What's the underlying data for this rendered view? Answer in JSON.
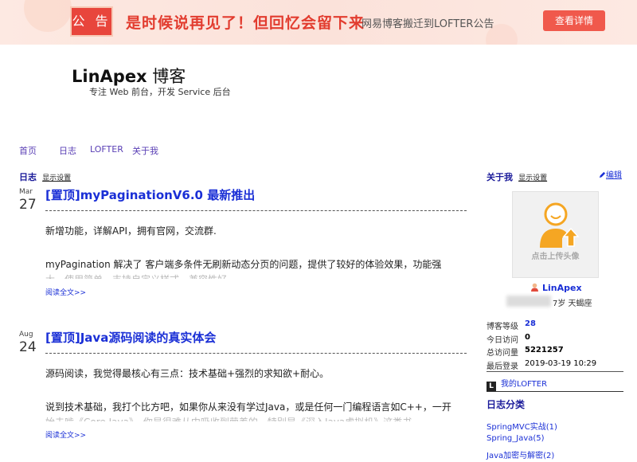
{
  "banner": {
    "seal": "公 告",
    "headline": "是时候说再见了！但回忆会留下来",
    "subtitle": "网易博客搬迁到LOFTER公告",
    "button": "查看详情"
  },
  "blog": {
    "title": "LinApex",
    "title_suffix": " 博客",
    "tagline": "专注 Web 前台，开发 Service 后台"
  },
  "nav": [
    "首页",
    "日志",
    "LOFTER",
    "关于我"
  ],
  "main": {
    "section_title": "日志",
    "section_settings": "显示设置",
    "posts": [
      {
        "month": "Mar",
        "day": "27",
        "title": "[置顶]myPaginationV6.0 最新推出",
        "p1": "新增功能，详解API，拥有官网，交流群.",
        "p2": "myPagination 解决了 客户端多条件无刷新动态分页的问题，提供了较好的体验效果，功能强",
        "p3": "大，使用简单，支持自定义样式，兼容性好。",
        "more": "阅读全文>>"
      },
      {
        "month": "Aug",
        "day": "24",
        "title": "[置顶]Java源码阅读的真实体会",
        "p1": "源码阅读，我觉得最核心有三点：技术基础+强烈的求知欲+耐心。",
        "p2": "说到技术基础，我打个比方吧，如果你从来没有学过Java，或是任何一门编程语言如C++，一开",
        "p3": "始去啃《Core Java》，你是很难从中吸收到营养的，特别是《深入Java虚拟机》这类书。",
        "more": "阅读全文>>"
      }
    ]
  },
  "sidebar": {
    "about_title": "关于我",
    "about_settings": "显示设置",
    "edit": "编辑",
    "avatar_caption": "点击上传头像",
    "profile_name": "LinApex",
    "profile_meta_tail": "7岁  天蝎座",
    "stats": [
      {
        "label": "博客等级",
        "value": "28",
        "style": "link"
      },
      {
        "label": "今日访问",
        "value": "0",
        "style": "bold"
      },
      {
        "label": "总访问量",
        "value": "5221257",
        "style": "bold"
      },
      {
        "label": "最后登录",
        "value": "2019-03-19 10:29",
        "style": "plain"
      }
    ],
    "lofter_icon": "L",
    "lofter_label": "我的LOFTER",
    "categories_title": "日志分类",
    "categories": [
      "SpringMVC实战(1)",
      "Spring_Java(5)",
      "Java加密与解密(2)"
    ]
  },
  "colors": {
    "banner_bg": "#fbe2da",
    "seal_red": "#e8453c",
    "headline_red": "#e23c2f",
    "button_red": "#f0594c",
    "link_blue": "#1a2fd6",
    "heading_navy": "#1a1a9a",
    "nav_purple": "#5a3fb5",
    "avatar_orange": "#f5a623"
  },
  "icons": [
    "announcement-seal",
    "avatar-placeholder-icon",
    "edit-pencil-icon",
    "user-small-icon",
    "lofter-icon"
  ]
}
